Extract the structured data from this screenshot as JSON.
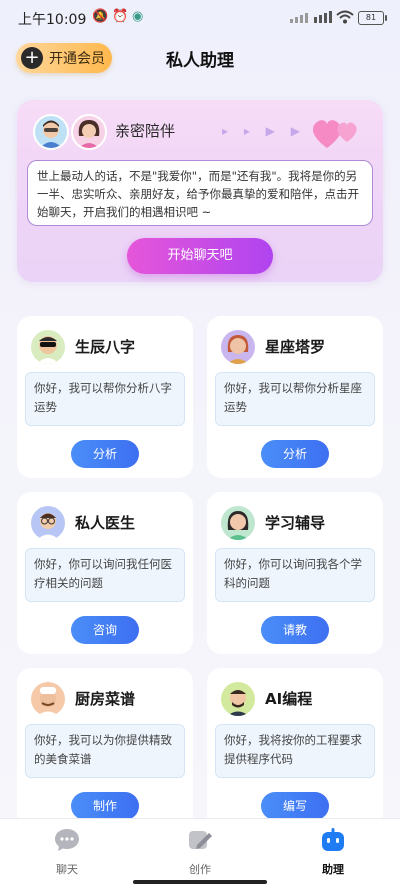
{
  "status_bar": {
    "time": "上午10:09",
    "battery": "81"
  },
  "header": {
    "vip_label": "开通会员",
    "title": "私人助理"
  },
  "hero": {
    "title": "亲密陪伴",
    "message": "世上最动人的话，不是\"我爱你\"，而是\"还有我\"。我将是你的另一半、忠实听众、亲朋好友，给予你最真挚的爱和陪伴，点击开始聊天，开启我们的相遇相识吧 ~",
    "button": "开始聊天吧"
  },
  "cards": [
    {
      "title": "生辰八字",
      "desc": "你好，我可以帮你分析八字运势",
      "button": "分析"
    },
    {
      "title": "星座塔罗",
      "desc": "你好，我可以帮你分析星座运势",
      "button": "分析"
    },
    {
      "title": "私人医生",
      "desc": "你好，你可以询问我任何医疗相关的问题",
      "button": "咨询"
    },
    {
      "title": "学习辅导",
      "desc": "你好，你可以询问我各个学科的问题",
      "button": "请教"
    },
    {
      "title": "厨房菜谱",
      "desc": "你好，我可以为你提供精致的美食菜谱",
      "button": "制作"
    },
    {
      "title": "AI编程",
      "desc": "你好，我将按你的工程要求提供程序代码",
      "button": "编写"
    }
  ],
  "tabs": [
    {
      "label": "聊天",
      "icon": "chat-icon"
    },
    {
      "label": "创作",
      "icon": "pen-icon"
    },
    {
      "label": "助理",
      "icon": "robot-icon",
      "active": true
    }
  ],
  "colors": {
    "accent_blue": "#3d6ff2",
    "hero_button": "#b044f0",
    "vip": "#ffb84d"
  }
}
